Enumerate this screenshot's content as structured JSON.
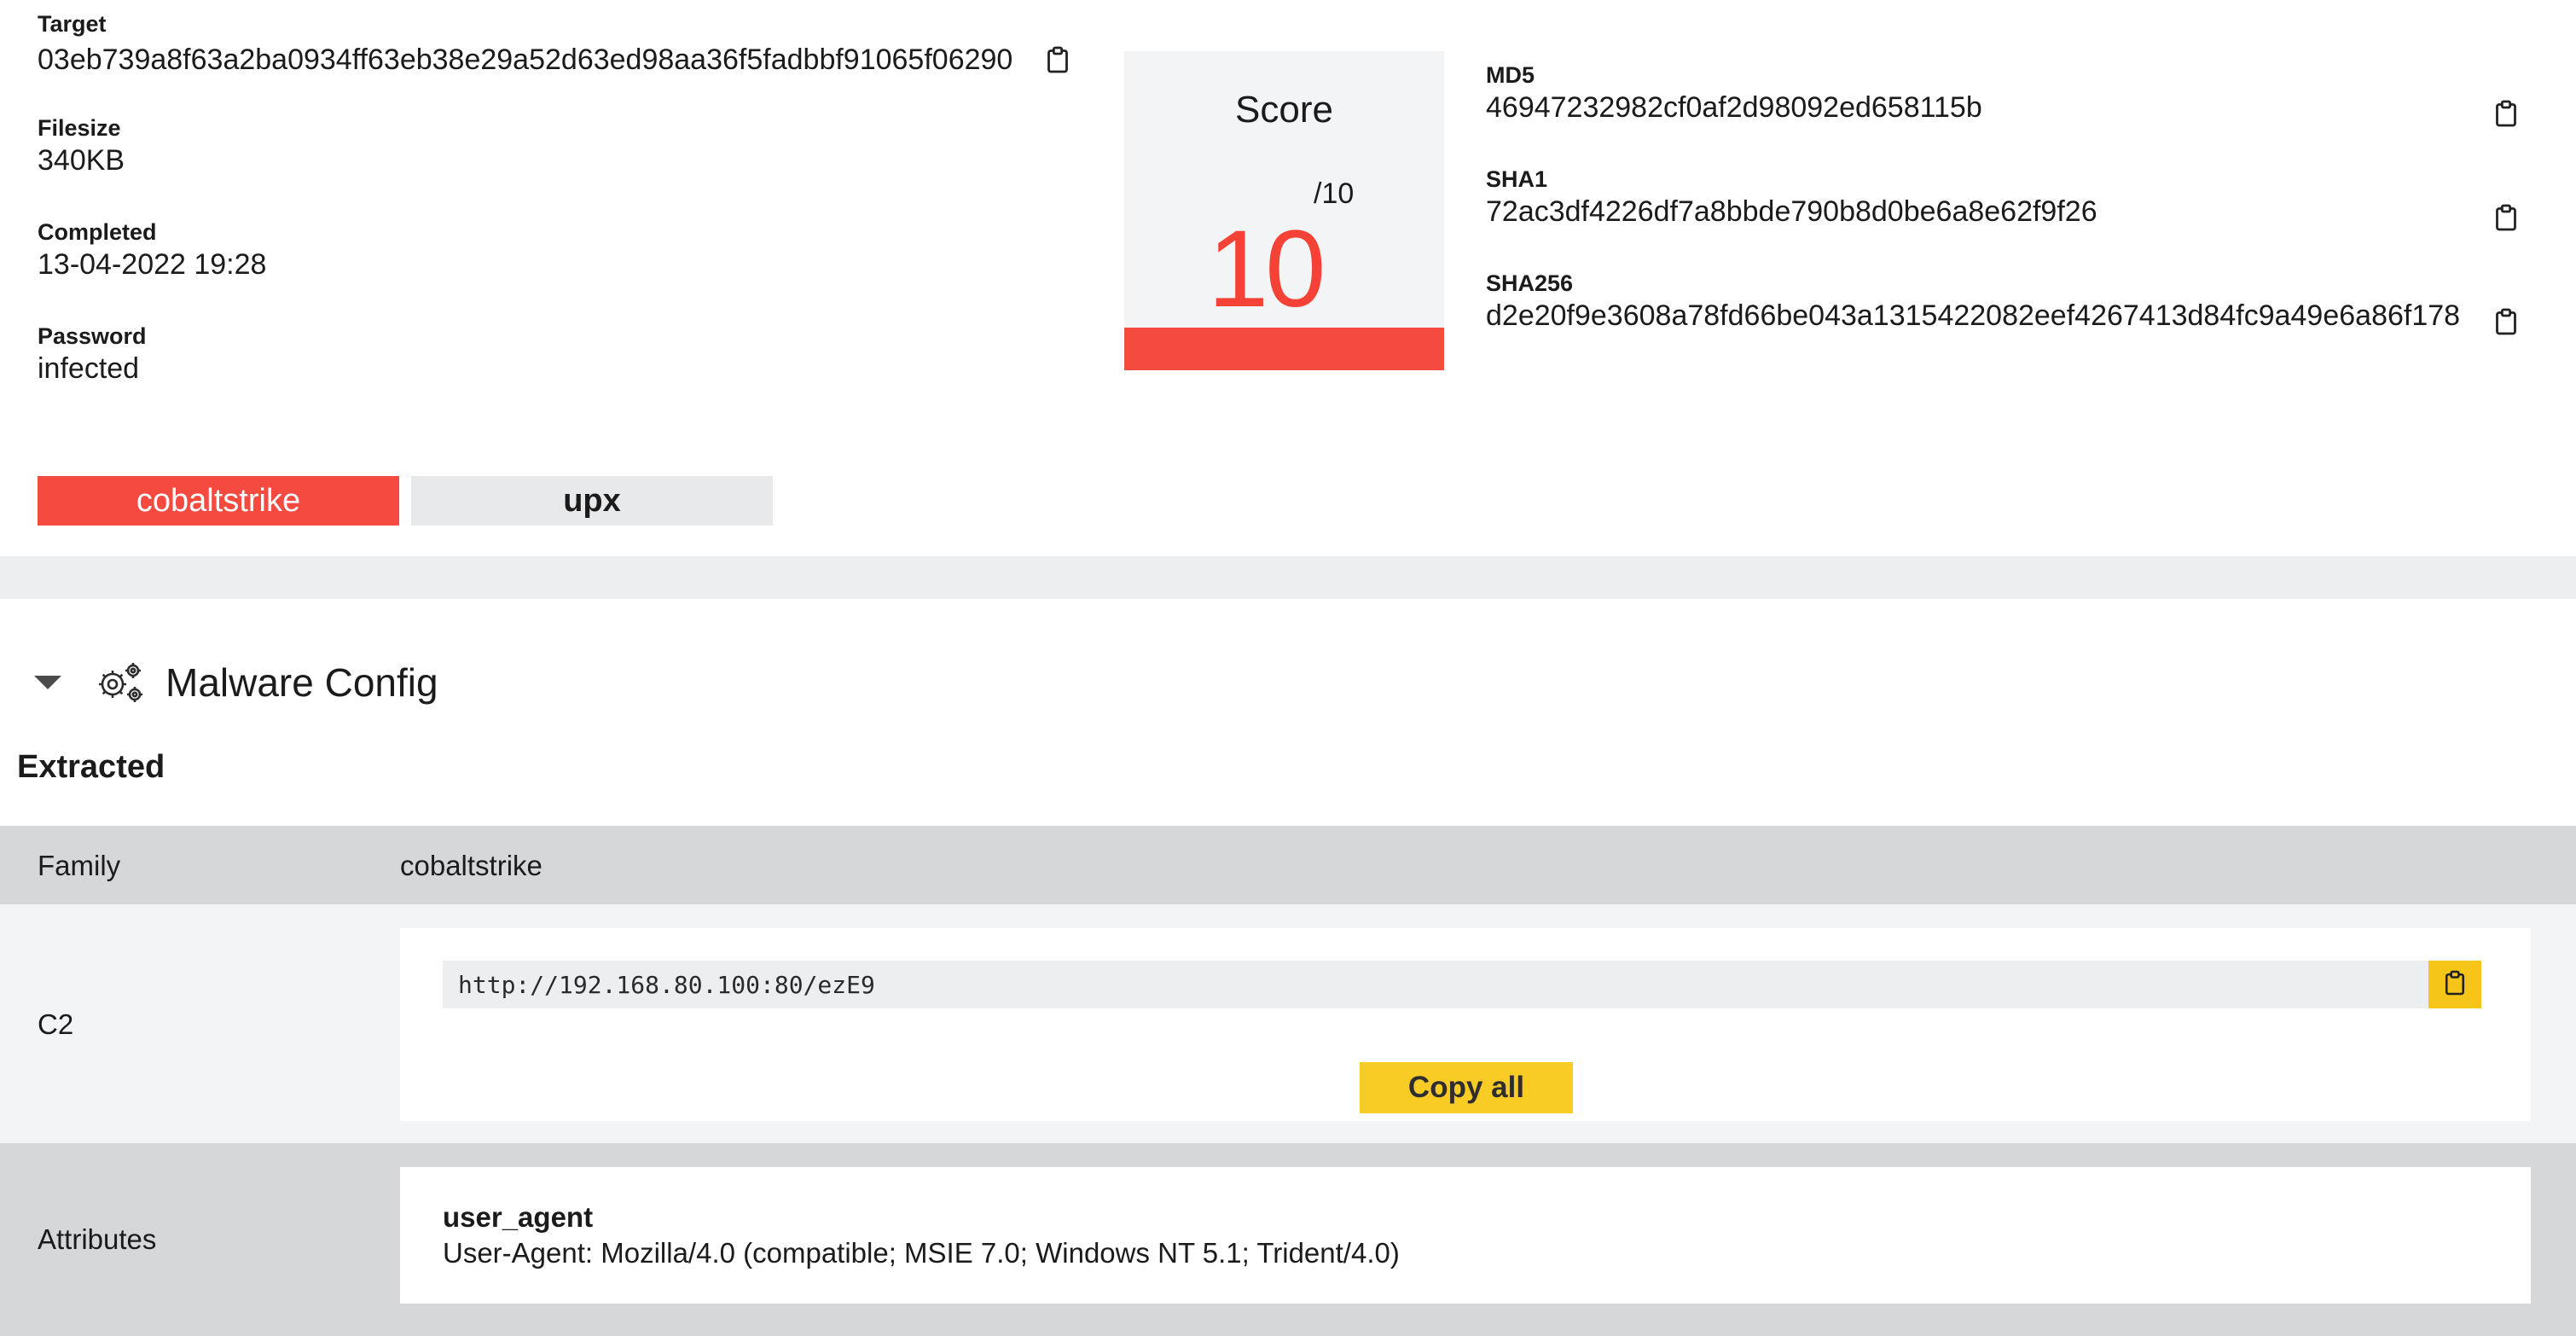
{
  "summary": {
    "target_label": "Target",
    "target_value": "03eb739a8f63a2ba0934ff63eb38e29a52d63ed98aa36f5fadbbf91065f06290",
    "filesize_label": "Filesize",
    "filesize_value": "340KB",
    "completed_label": "Completed",
    "completed_value": "13-04-2022 19:28",
    "password_label": "Password",
    "password_value": "infected"
  },
  "score": {
    "title": "Score",
    "value": "10",
    "max": "/10",
    "fraction": 1.0,
    "bar_color": "#f44a3f"
  },
  "hashes": {
    "md5_label": "MD5",
    "md5_value": "46947232982cf0af2d98092ed658115b",
    "sha1_label": "SHA1",
    "sha1_value": "72ac3df4226df7a8bbde790b8d0be6a8e62f9f26",
    "sha256_label": "SHA256",
    "sha256_value": "d2e20f9e3608a78fd66be043a1315422082eef4267413d84fc9a49e6a86f178"
  },
  "tags": [
    {
      "label": "cobaltstrike",
      "color": "#f44a3f"
    },
    {
      "label": "upx",
      "color": "#e8e9eb"
    }
  ],
  "config": {
    "section_title": "Malware Config",
    "extracted_label": "Extracted",
    "family_label": "Family",
    "family_value": "cobaltstrike",
    "c2_label": "C2",
    "c2_url": "http://192.168.80.100:80/ezE9",
    "copy_all_label": "Copy all",
    "attributes_label": "Attributes",
    "attr_key": "user_agent",
    "attr_value": "User-Agent: Mozilla/4.0 (compatible; MSIE 7.0; Windows NT 5.1; Trident/4.0)"
  },
  "icons": {
    "clipboard": "clipboard-icon",
    "caret": "caret-down-icon",
    "gears": "gears-icon"
  },
  "colors": {
    "accent_red": "#f44336",
    "accent_yellow": "#f9cb25"
  }
}
